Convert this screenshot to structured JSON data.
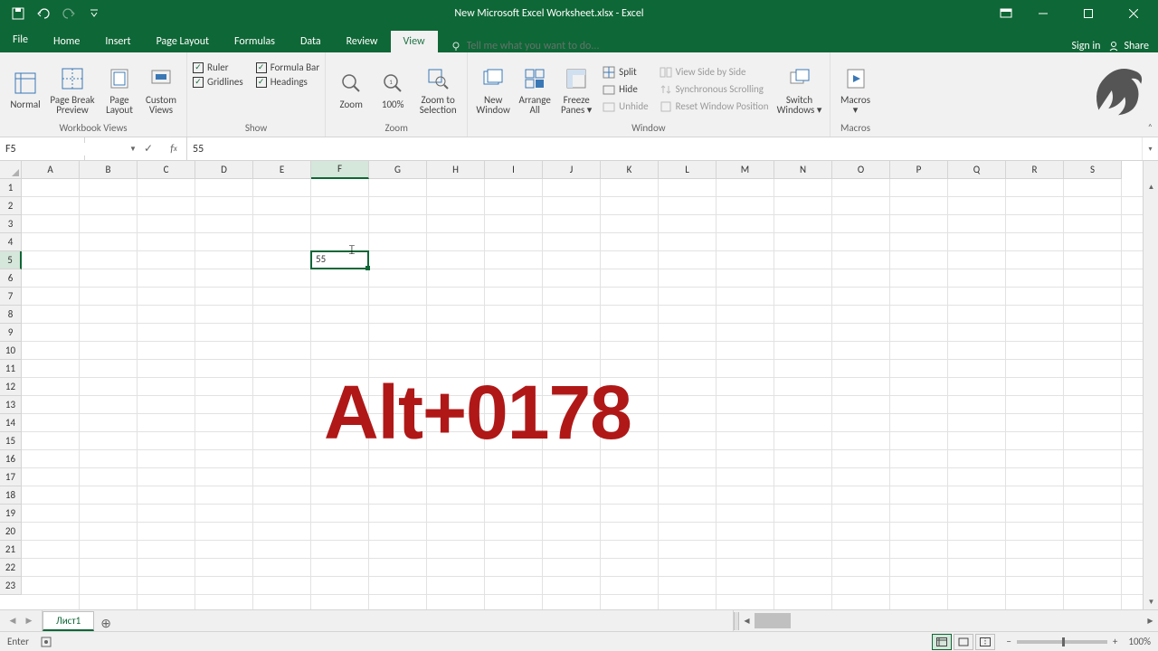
{
  "title": "New Microsoft Excel Worksheet.xlsx - Excel",
  "tabs": {
    "file": "File",
    "list": [
      "Home",
      "Insert",
      "Page Layout",
      "Formulas",
      "Data",
      "Review",
      "View"
    ],
    "active": "View",
    "tellme_placeholder": "Tell me what you want to do...",
    "signin": "Sign in",
    "share": "Share"
  },
  "ribbon": {
    "workbook_views": {
      "label": "Workbook Views",
      "normal": "Normal",
      "page_break": "Page Break\nPreview",
      "page_layout": "Page\nLayout",
      "custom_views": "Custom\nViews"
    },
    "show": {
      "label": "Show",
      "ruler": "Ruler",
      "gridlines": "Gridlines",
      "formula_bar": "Formula Bar",
      "headings": "Headings"
    },
    "zoom": {
      "label": "Zoom",
      "zoom": "Zoom",
      "hundred": "100%",
      "to_selection": "Zoom to\nSelection"
    },
    "window": {
      "label": "Window",
      "new_window": "New\nWindow",
      "arrange_all": "Arrange\nAll",
      "freeze": "Freeze\nPanes",
      "split": "Split",
      "hide": "Hide",
      "unhide": "Unhide",
      "side_by_side": "View Side by Side",
      "sync_scroll": "Synchronous Scrolling",
      "reset_pos": "Reset Window Position",
      "switch": "Switch\nWindows"
    },
    "macros": {
      "label": "Macros",
      "macros": "Macros"
    }
  },
  "name_box": "F5",
  "formula_value": "55",
  "columns": [
    "A",
    "B",
    "C",
    "D",
    "E",
    "F",
    "G",
    "H",
    "I",
    "J",
    "K",
    "L",
    "M",
    "N",
    "O",
    "P",
    "Q",
    "R",
    "S"
  ],
  "active_column": "F",
  "rows": 23,
  "active_row": 5,
  "active_cell_value": "55",
  "overlay_text": "Alt+0178",
  "sheet_tab": "Лист1",
  "status": {
    "mode": "Enter",
    "zoom": "100%"
  }
}
